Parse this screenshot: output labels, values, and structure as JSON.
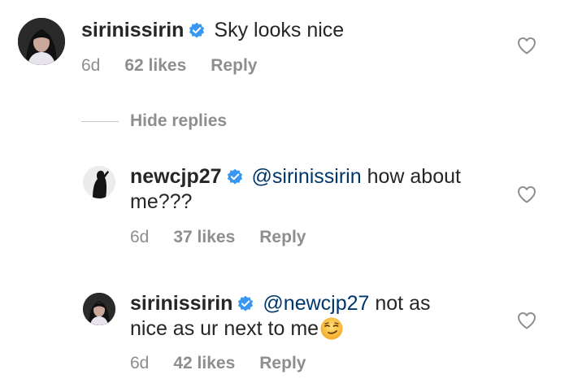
{
  "comments": [
    {
      "username": "sirinissirin",
      "mention": "",
      "text": "Sky looks nice",
      "time": "6d",
      "likes": "62 likes",
      "reply": "Reply"
    },
    {
      "username": "newcjp27",
      "mention": "@sirinissirin",
      "text_line1": "how about",
      "text_line2": "me???",
      "time": "6d",
      "likes": "37 likes",
      "reply": "Reply"
    },
    {
      "username": "sirinissirin",
      "mention": "@newcjp27",
      "text_line1": "not as",
      "text_line2": "nice as ur next to me",
      "emoji": "smirking-face",
      "time": "6d",
      "likes": "42 likes",
      "reply": "Reply"
    }
  ],
  "hide_replies": "Hide replies",
  "colors": {
    "text": "#262626",
    "meta": "#8e8e8e",
    "mention": "#00376b",
    "verified": "#3897f0"
  },
  "icons": {
    "verified": "verified-badge-icon",
    "like": "heart-outline-icon"
  }
}
